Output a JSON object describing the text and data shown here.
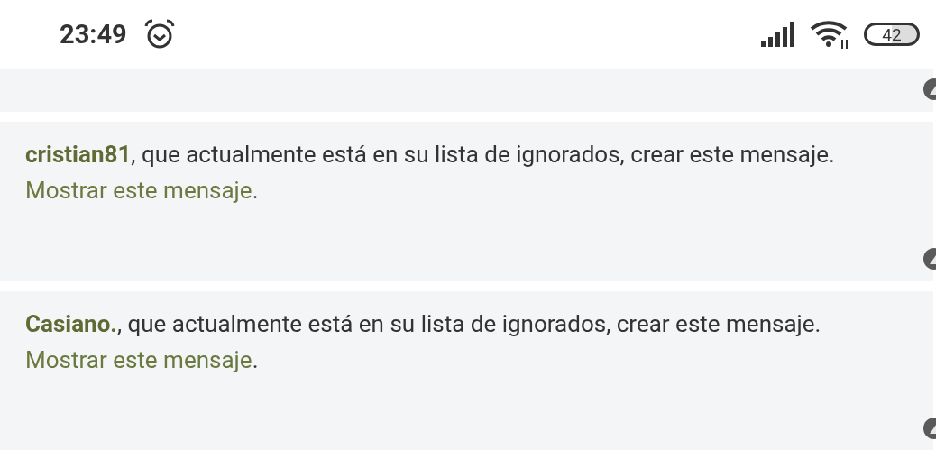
{
  "status_bar": {
    "time": "23:49",
    "battery": "42"
  },
  "posts": [
    {
      "kind": "collapsed"
    },
    {
      "kind": "ignored",
      "notice": "**cristian81**, que actualmente está en su lista de ignorados, crear este mensaje.",
      "link": "Mostrar este mensaje",
      "after_link": "."
    },
    {
      "kind": "ignored",
      "notice": "**Casiano.**, que actualmente está en su lista de ignorados, crear este mensaje.",
      "link": "Mostrar este mensaje",
      "after_link": "."
    }
  ]
}
